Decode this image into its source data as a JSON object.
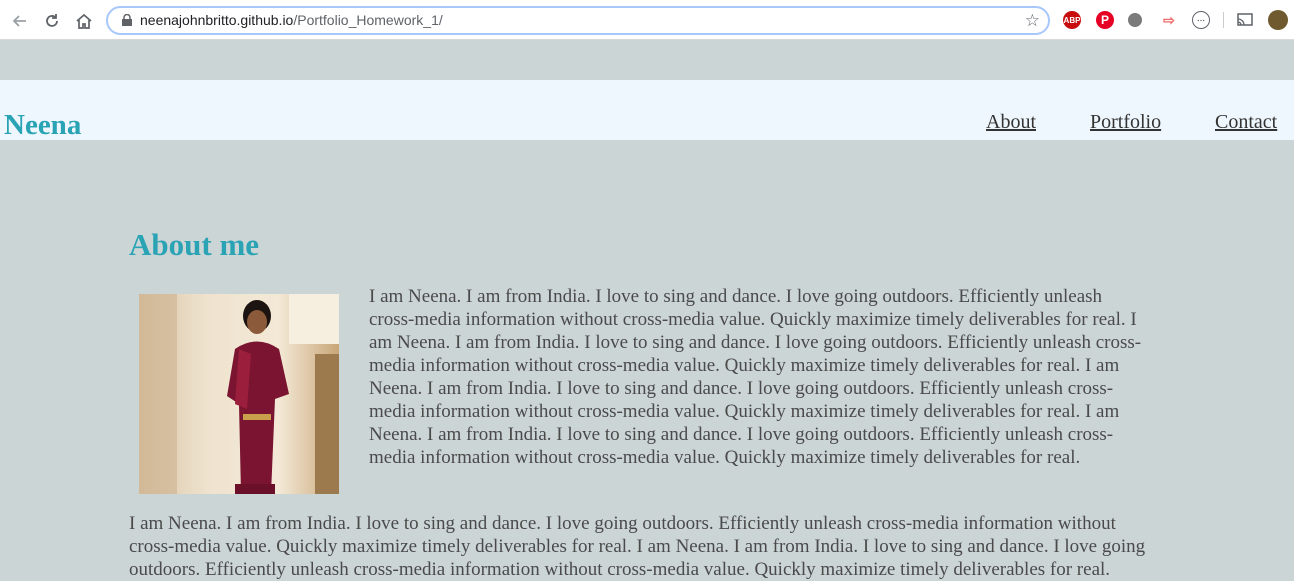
{
  "browser": {
    "url_host": "neenajohnbritto.github.io",
    "url_path": "/Portfolio_Homework_1/"
  },
  "site": {
    "brand": "Neena",
    "nav": [
      "About",
      "Portfolio",
      "Contact"
    ]
  },
  "about": {
    "title": "About me",
    "paragraph1": "I am Neena. I am from India. I love to sing and dance. I love going outdoors. Efficiently unleash cross-media information without cross-media value. Quickly maximize timely deliverables for real. I am Neena. I am from India. I love to sing and dance. I love going outdoors. Efficiently unleash cross-media information without cross-media value. Quickly maximize timely deliverables for real. I am Neena. I am from India. I love to sing and dance. I love going outdoors. Efficiently unleash cross-media information without cross-media value. Quickly maximize timely deliverables for real. I am Neena. I am from India. I love to sing and dance. I love going outdoors. Efficiently unleash cross-media information without cross-media value. Quickly maximize timely deliverables for real.",
    "paragraph2": "I am Neena. I am from India. I love to sing and dance. I love going outdoors. Efficiently unleash cross-media information without cross-media value. Quickly maximize timely deliverables for real. I am Neena. I am from India. I love to sing and dance. I love going outdoors. Efficiently unleash cross-media information without cross-media value. Quickly maximize timely deliverables for real."
  },
  "colors": {
    "page_bg": "#ccd5d6",
    "header_bg": "#eef7fd",
    "accent": "#2aa3b5"
  },
  "icons": {
    "toolbar": [
      "back-arrow-icon",
      "reload-icon",
      "home-icon",
      "lock-icon",
      "star-icon"
    ],
    "extensions": [
      "adblock-plus-icon",
      "pinterest-icon",
      "extension-grey-icon",
      "extension-pink-icon",
      "extension-circle-icon",
      "cast-icon",
      "profile-avatar"
    ]
  }
}
